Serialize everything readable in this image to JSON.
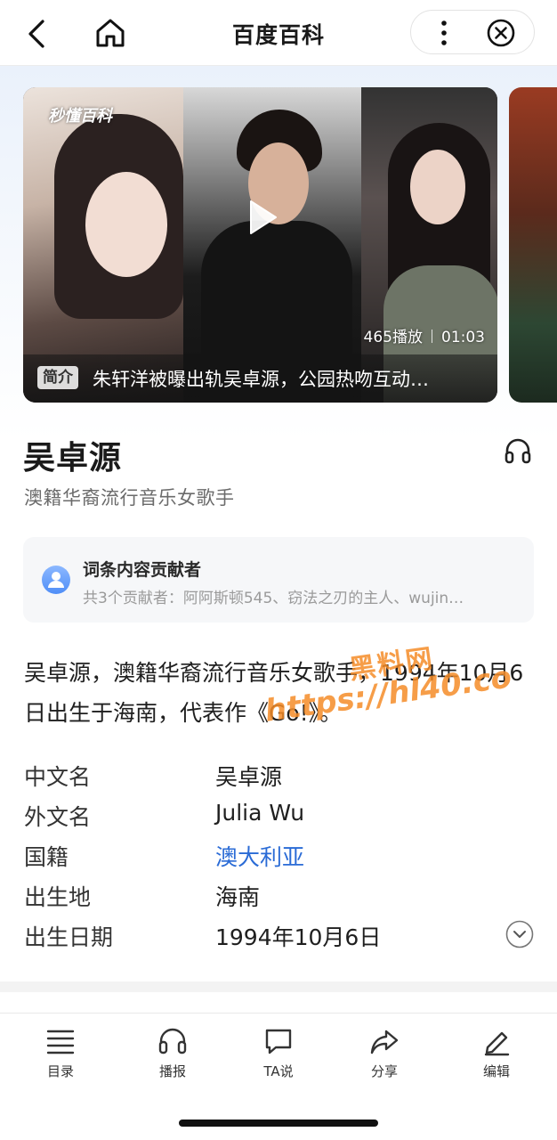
{
  "topbar": {
    "title": "百度百科"
  },
  "video": {
    "brand_logo": "秒懂百科",
    "plays": "465播放",
    "duration": "01:03",
    "caption_tag": "简介",
    "caption": "朱轩洋被曝出轨吴卓源，公园热吻互动…"
  },
  "entry": {
    "title": "吴卓源",
    "subtitle": "澳籍华裔流行音乐女歌手"
  },
  "contributors": {
    "title": "词条内容贡献者",
    "list": "共3个贡献者：阿阿斯顿545、窃法之刃的主人、wujin…"
  },
  "summary": "吴卓源，澳籍华裔流行音乐女歌手，1994年10月6日出生于海南，代表作《Go!》。",
  "infobox": [
    {
      "key": "中文名",
      "value": "吴卓源"
    },
    {
      "key": "外文名",
      "value": "Julia Wu"
    },
    {
      "key": "国籍",
      "value": "澳大利亚"
    },
    {
      "key": "出生地",
      "value": "海南"
    },
    {
      "key": "出生日期",
      "value": "1994年10月6日"
    }
  ],
  "toolbar": {
    "catalog": "目录",
    "broadcast": "播报",
    "ta_says": "TA说",
    "share": "分享",
    "edit": "编辑"
  },
  "watermark": {
    "brand": "黑料网",
    "url": "https://hl40.co"
  },
  "colors": {
    "link": "#2a6bd6",
    "watermark": "#f58c28",
    "band": "#eaf1fb"
  }
}
